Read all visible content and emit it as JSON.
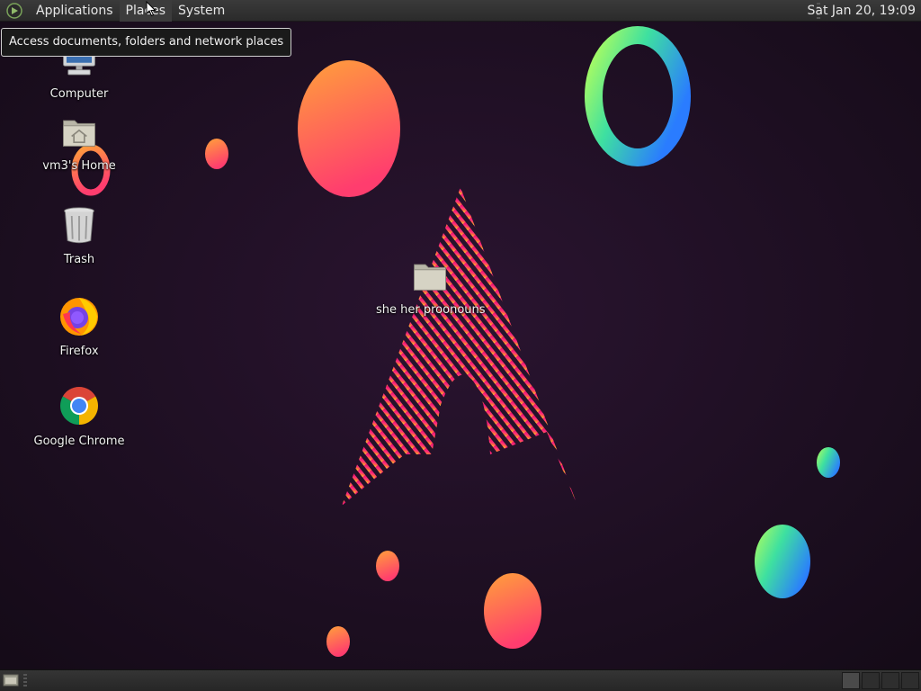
{
  "top_panel": {
    "menus": [
      "Applications",
      "Places",
      "System"
    ],
    "clock": "Sat Jan 20, 19:09"
  },
  "tooltip": "Access documents, folders and network places",
  "desktop_icons": {
    "computer": "Computer",
    "home": "vm3's Home",
    "trash": "Trash",
    "firefox": "Firefox",
    "chrome": "Google Chrome",
    "folder": "she her proonouns"
  },
  "colors": {
    "background": "#1c0f20",
    "accent_pink": "#e91e78",
    "accent_orange": "#ff8a2a"
  }
}
